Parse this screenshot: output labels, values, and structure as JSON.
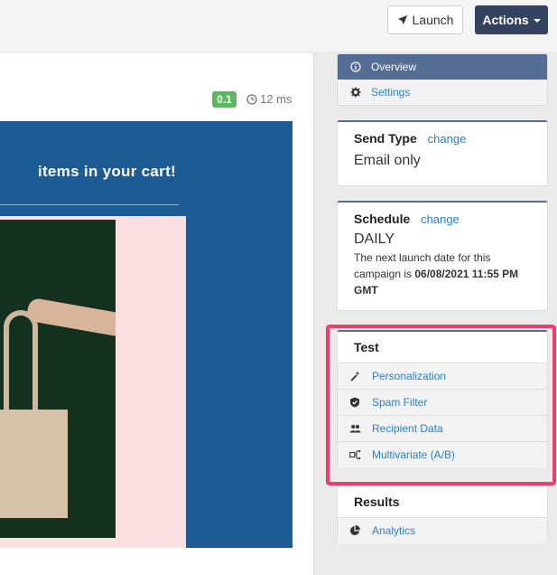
{
  "header": {
    "launch_label": "Launch",
    "actions_label": "Actions"
  },
  "preview": {
    "score_badge": "0.1",
    "timing": "12 ms",
    "email_headline": "items in your cart!"
  },
  "nav": {
    "items": [
      {
        "label": "Overview",
        "active": true
      },
      {
        "label": "Settings",
        "active": false
      }
    ]
  },
  "send_type": {
    "title": "Send Type",
    "change_label": "change",
    "value": "Email only"
  },
  "schedule": {
    "title": "Schedule",
    "change_label": "change",
    "value": "DAILY",
    "note_prefix": "The next launch date for this campaign is ",
    "note_date": "06/08/2021 11:55 PM GMT"
  },
  "test": {
    "title": "Test",
    "items": [
      {
        "label": "Personalization",
        "icon": "magic-wand-icon"
      },
      {
        "label": "Spam Filter",
        "icon": "shield-check-icon"
      },
      {
        "label": "Recipient Data",
        "icon": "people-icon"
      },
      {
        "label": "Multivariate (A/B)",
        "icon": "ab-split-icon"
      }
    ]
  },
  "results": {
    "title": "Results",
    "items": [
      {
        "label": "Analytics",
        "icon": "pie-chart-icon"
      }
    ]
  },
  "colors": {
    "accent": "#546d94",
    "primary_button": "#33425f",
    "highlight": "#f13d6b",
    "link": "#2a80c8",
    "badge": "#5cb85c",
    "email_bg": "#1c5b94"
  }
}
